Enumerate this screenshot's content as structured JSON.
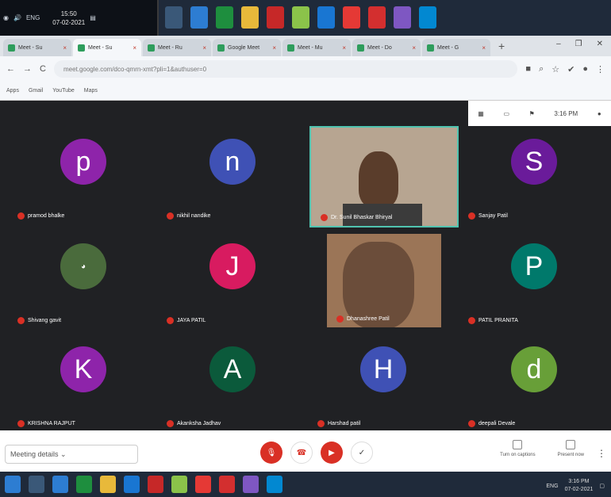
{
  "top_tray": {
    "lang": "ENG",
    "time": "15:50",
    "date": "07-02-2021"
  },
  "browser": {
    "tabs": [
      "Meet - Su",
      "Meet - Su",
      "Meet - Ru",
      "Google Meet",
      "Meet - Mu",
      "Meet - Do",
      "Meet - G"
    ],
    "url": "meet.google.com/dco-qmrn-xmt?pli=1&authuser=0",
    "bookmarks": [
      "Apps",
      "Gmail",
      "YouTube",
      "Maps"
    ]
  },
  "meet": {
    "clock": "3:16 PM",
    "participants": [
      {
        "initial": "p",
        "name": "pramod bhalke",
        "color": "#8e24aa"
      },
      {
        "initial": "n",
        "name": "nikhil nandike",
        "color": "#3f51b5"
      },
      {
        "initial": "",
        "name": "Dr. Sunil Bhaskar Bhiryal",
        "color": "#7b6a58"
      },
      {
        "initial": "S",
        "name": "Sanjay Patil",
        "color": "#6a1b9a"
      },
      {
        "initial": "",
        "name": "Shivang gavit",
        "color": "#4a6b3c"
      },
      {
        "initial": "J",
        "name": "JAYA PATIL",
        "color": "#d81b60"
      },
      {
        "initial": "",
        "name": "Dhanashree Patil",
        "color": "#6b4d3a"
      },
      {
        "initial": "P",
        "name": "PATIL PRANITA",
        "color": "#00796b"
      },
      {
        "initial": "K",
        "name": "KRISHNA RAJPUT",
        "color": "#8e24aa"
      },
      {
        "initial": "A",
        "name": "Akanksha Jadhav",
        "color": "#0b5a3b"
      },
      {
        "initial": "H",
        "name": "Harshad patil",
        "color": "#3f51b5"
      },
      {
        "initial": "d",
        "name": "deepali Devale",
        "color": "#689f38"
      }
    ]
  },
  "bottom": {
    "meeting_details": "Meeting details",
    "captions_label": "Turn on captions",
    "present_label": "Present now"
  },
  "taskbar": {
    "lang": "ENG",
    "time": "3:16 PM",
    "date": "07-02-2021"
  }
}
